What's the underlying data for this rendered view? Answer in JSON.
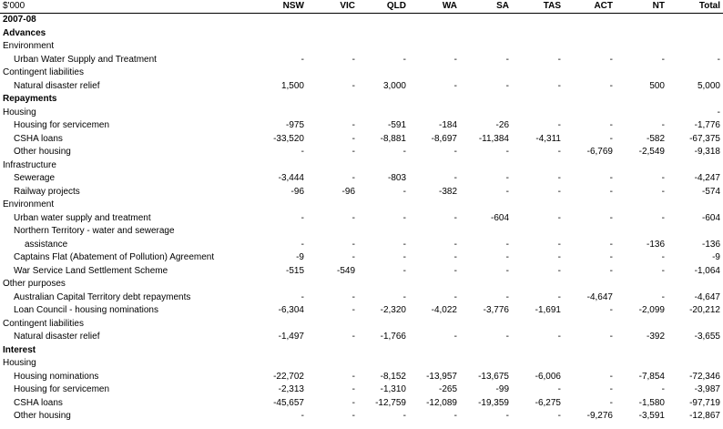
{
  "table": {
    "unit_label": "$'000",
    "columns": [
      "NSW",
      "VIC",
      "QLD",
      "WA",
      "SA",
      "TAS",
      "ACT",
      "NT",
      "Total"
    ],
    "rows": [
      {
        "label": "2007-08",
        "style": "year",
        "values": [
          "",
          "",
          "",
          "",
          "",
          "",
          "",
          "",
          ""
        ]
      },
      {
        "label": "Advances",
        "style": "section",
        "values": [
          "",
          "",
          "",
          "",
          "",
          "",
          "",
          "",
          ""
        ]
      },
      {
        "label": "Environment",
        "style": "category",
        "values": [
          "",
          "",
          "",
          "",
          "",
          "",
          "",
          "",
          ""
        ]
      },
      {
        "label": "Urban Water Supply and Treatment",
        "style": "indent",
        "values": [
          "-",
          "-",
          "-",
          "-",
          "-",
          "-",
          "-",
          "-",
          "-"
        ]
      },
      {
        "label": "Contingent liabilities",
        "style": "category",
        "values": [
          "",
          "",
          "",
          "",
          "",
          "",
          "",
          "",
          ""
        ]
      },
      {
        "label": "Natural disaster relief",
        "style": "indent",
        "values": [
          "1,500",
          "-",
          "3,000",
          "-",
          "-",
          "-",
          "-",
          "500",
          "5,000"
        ]
      },
      {
        "label": "Repayments",
        "style": "section",
        "values": [
          "",
          "",
          "",
          "",
          "",
          "",
          "",
          "",
          ""
        ]
      },
      {
        "label": "Housing",
        "style": "category",
        "values": [
          "",
          "",
          "",
          "",
          "",
          "",
          "",
          "",
          "-"
        ]
      },
      {
        "label": "Housing for servicemen",
        "style": "indent",
        "values": [
          "-975",
          "-",
          "-591",
          "-184",
          "-26",
          "-",
          "-",
          "-",
          "-1,776"
        ]
      },
      {
        "label": "CSHA loans",
        "style": "indent",
        "values": [
          "-33,520",
          "-",
          "-8,881",
          "-8,697",
          "-11,384",
          "-4,311",
          "-",
          "-582",
          "-67,375"
        ]
      },
      {
        "label": "Other housing",
        "style": "indent",
        "values": [
          "-",
          "-",
          "-",
          "-",
          "-",
          "-",
          "-6,769",
          "-2,549",
          "-9,318"
        ]
      },
      {
        "label": "Infrastructure",
        "style": "category",
        "values": [
          "",
          "",
          "",
          "",
          "",
          "",
          "",
          "",
          ""
        ]
      },
      {
        "label": "Sewerage",
        "style": "indent",
        "values": [
          "-3,444",
          "-",
          "-803",
          "-",
          "-",
          "-",
          "-",
          "-",
          "-4,247"
        ]
      },
      {
        "label": "Railway projects",
        "style": "indent",
        "values": [
          "-96",
          "-96",
          "-",
          "-382",
          "-",
          "-",
          "-",
          "-",
          "-574"
        ]
      },
      {
        "label": "Environment",
        "style": "category",
        "values": [
          "",
          "",
          "",
          "",
          "",
          "",
          "",
          "",
          ""
        ]
      },
      {
        "label": "Urban water supply and treatment",
        "style": "indent",
        "values": [
          "-",
          "-",
          "-",
          "-",
          "-604",
          "-",
          "-",
          "-",
          "-604"
        ]
      },
      {
        "label": "Northern Territory - water and sewerage",
        "style": "indent",
        "values": [
          "",
          "",
          "",
          "",
          "",
          "",
          "",
          "",
          ""
        ]
      },
      {
        "label": "assistance",
        "style": "indent2",
        "values": [
          "-",
          "-",
          "-",
          "-",
          "-",
          "-",
          "-",
          "-136",
          "-136"
        ]
      },
      {
        "label": "Captains Flat (Abatement of Pollution) Agreement",
        "style": "indent",
        "values": [
          "-9",
          "-",
          "-",
          "-",
          "-",
          "-",
          "-",
          "-",
          "-9"
        ]
      },
      {
        "label": "War Service Land Settlement Scheme",
        "style": "indent",
        "values": [
          "-515",
          "-549",
          "-",
          "-",
          "-",
          "-",
          "-",
          "-",
          "-1,064"
        ]
      },
      {
        "label": "Other purposes",
        "style": "category",
        "values": [
          "",
          "",
          "",
          "",
          "",
          "",
          "",
          "",
          ""
        ]
      },
      {
        "label": "Australian Capital Territory debt repayments",
        "style": "indent",
        "values": [
          "-",
          "-",
          "-",
          "-",
          "-",
          "-",
          "-4,647",
          "-",
          "-4,647"
        ]
      },
      {
        "label": "Loan Council - housing nominations",
        "style": "indent",
        "values": [
          "-6,304",
          "-",
          "-2,320",
          "-4,022",
          "-3,776",
          "-1,691",
          "-",
          "-2,099",
          "-20,212"
        ]
      },
      {
        "label": "Contingent liabilities",
        "style": "category",
        "values": [
          "",
          "",
          "",
          "",
          "",
          "",
          "",
          "",
          ""
        ]
      },
      {
        "label": "Natural disaster relief",
        "style": "indent",
        "values": [
          "-1,497",
          "-",
          "-1,766",
          "-",
          "-",
          "-",
          "-",
          "-392",
          "-3,655"
        ]
      },
      {
        "label": "Interest",
        "style": "section",
        "values": [
          "",
          "",
          "",
          "",
          "",
          "",
          "",
          "",
          ""
        ]
      },
      {
        "label": "Housing",
        "style": "category",
        "values": [
          "",
          "",
          "",
          "",
          "",
          "",
          "",
          "",
          ""
        ]
      },
      {
        "label": "Housing nominations",
        "style": "indent",
        "values": [
          "-22,702",
          "-",
          "-8,152",
          "-13,957",
          "-13,675",
          "-6,006",
          "-",
          "-7,854",
          "-72,346"
        ]
      },
      {
        "label": "Housing for servicemen",
        "style": "indent",
        "values": [
          "-2,313",
          "-",
          "-1,310",
          "-265",
          "-99",
          "-",
          "-",
          "-",
          "-3,987"
        ]
      },
      {
        "label": "CSHA loans",
        "style": "indent",
        "values": [
          "-45,657",
          "-",
          "-12,759",
          "-12,089",
          "-19,359",
          "-6,275",
          "-",
          "-1,580",
          "-97,719"
        ]
      },
      {
        "label": "Other housing",
        "style": "indent",
        "values": [
          "-",
          "-",
          "-",
          "-",
          "-",
          "-",
          "-9,276",
          "-3,591",
          "-12,867"
        ]
      }
    ]
  }
}
